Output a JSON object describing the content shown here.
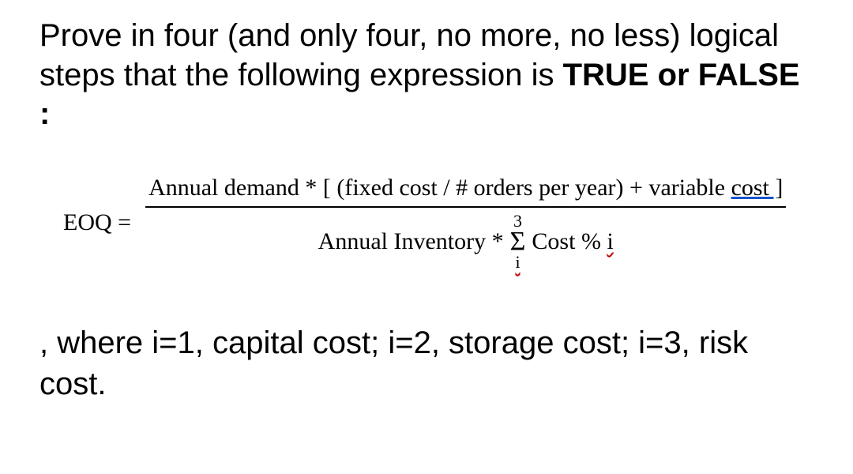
{
  "heading": {
    "part1": "Prove in four (and only four, no more, no less) logical steps that the following expression is ",
    "bold": "TRUE or FALSE",
    "colon": ":"
  },
  "equation": {
    "lhs": "EOQ =",
    "numerator_prefix": "Annual demand * [ (fixed cost / # orders per year) + variable ",
    "numerator_underlined": "cost ]",
    "denom_left": "Annual Inventory * ",
    "sigma_top": "3",
    "sigma_symbol": "Σ",
    "sigma_bottom": "i",
    "denom_right_prefix": " Cost % ",
    "denom_right_i": "i"
  },
  "where": ", where i=1, capital cost; i=2, storage cost; i=3, risk cost."
}
